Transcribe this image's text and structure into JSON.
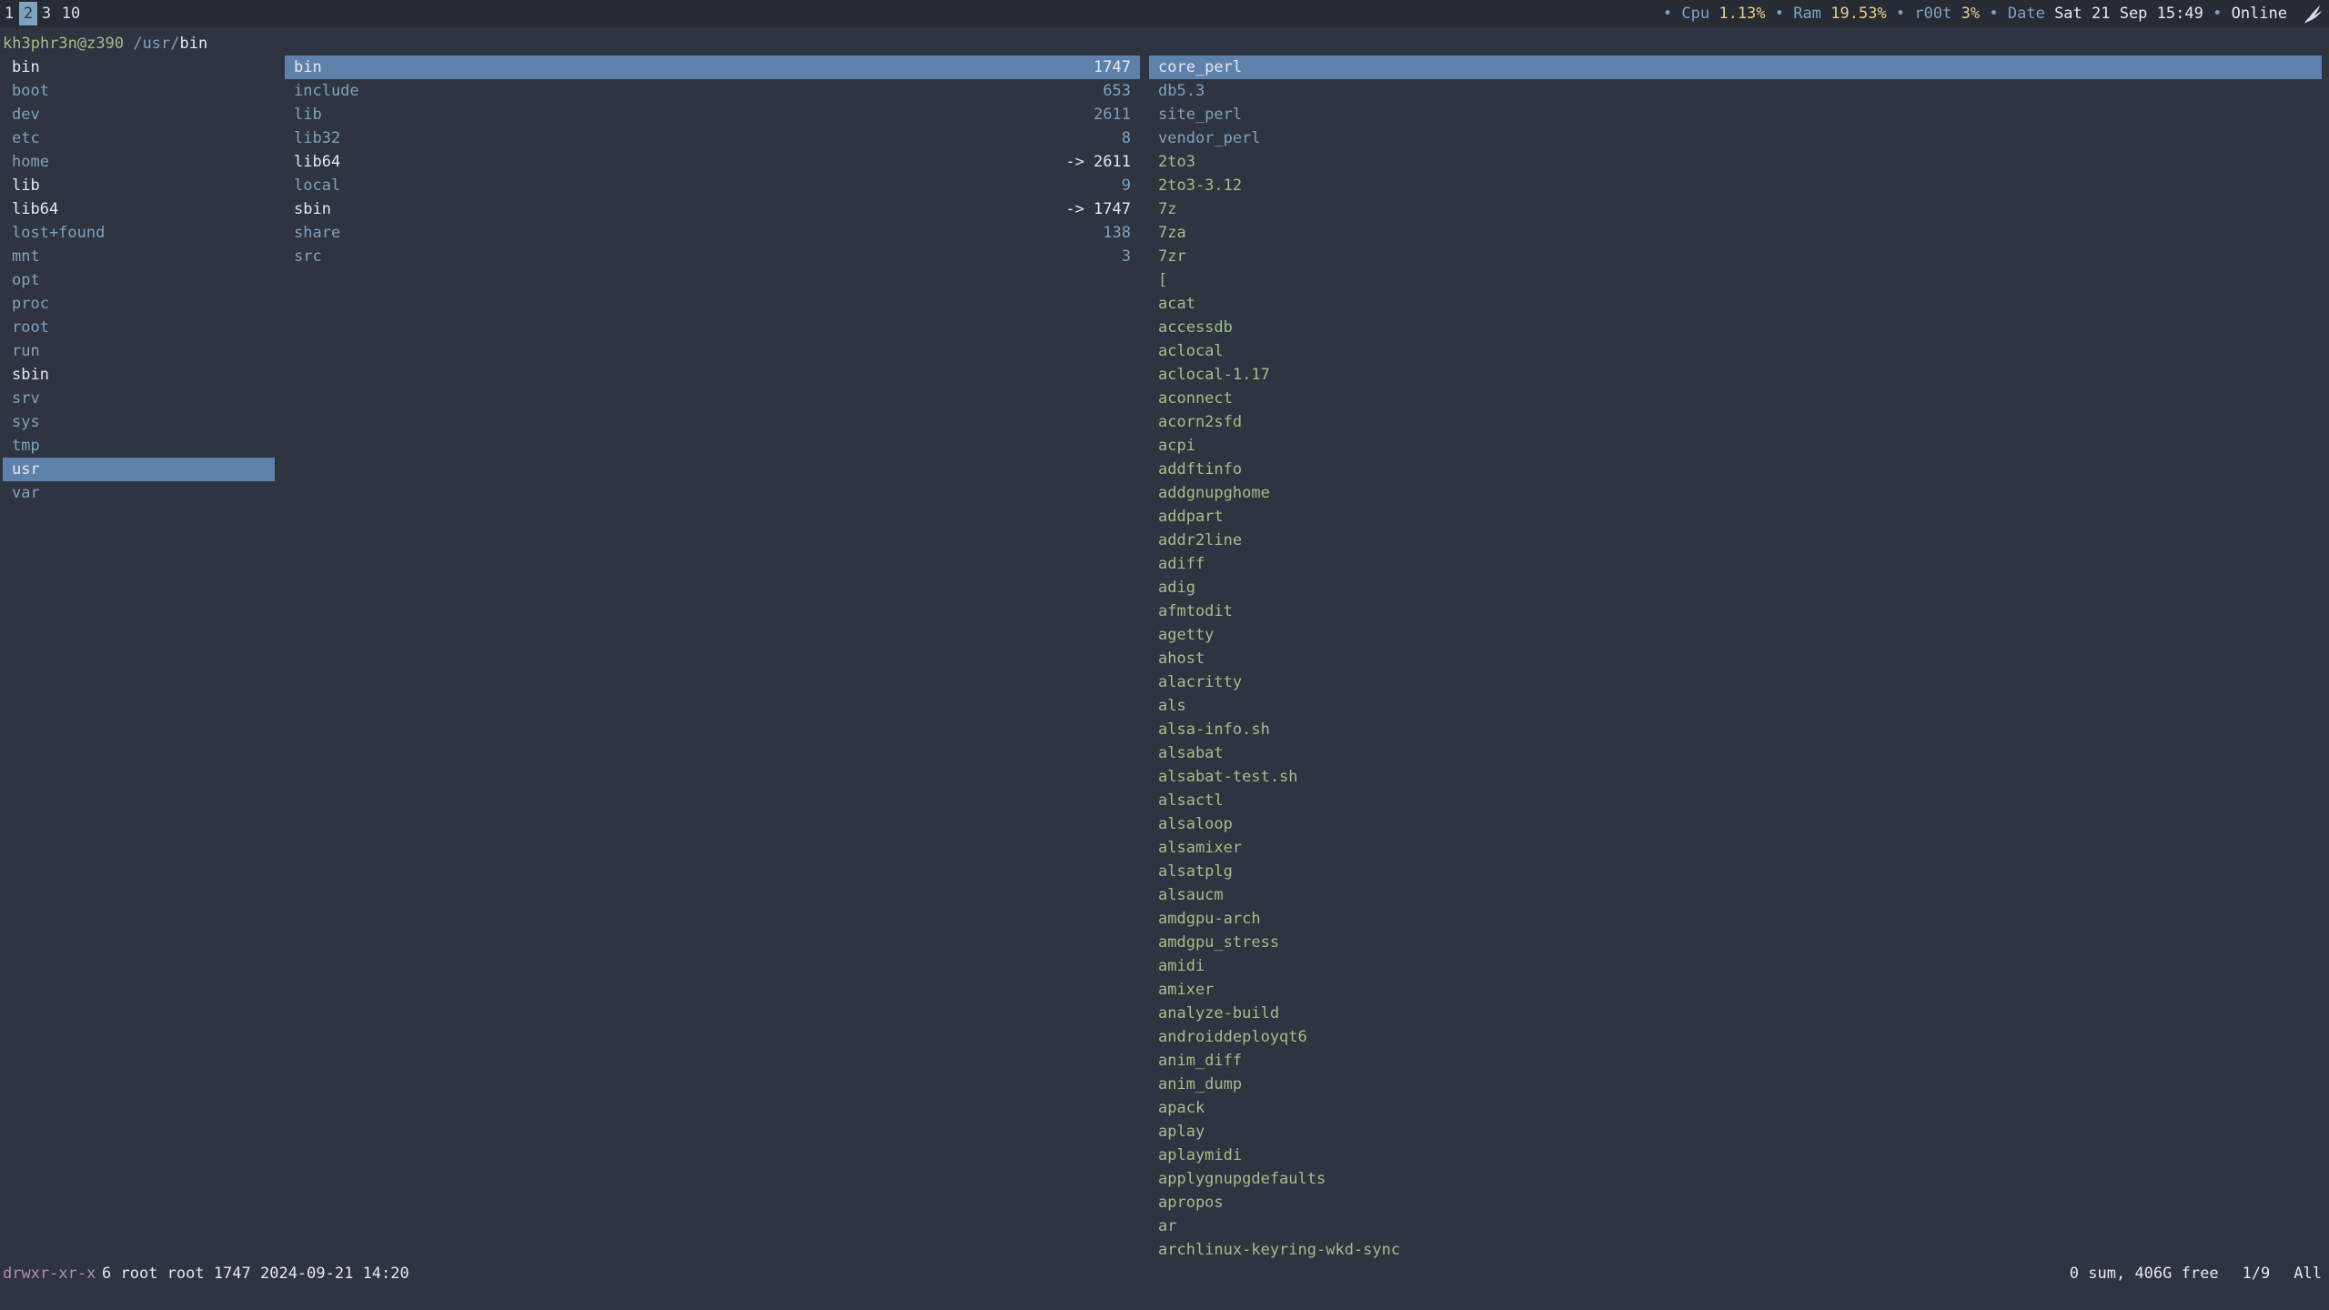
{
  "workspaces": [
    "1",
    "2",
    "3",
    "10"
  ],
  "status": {
    "cpu_label": "Cpu",
    "cpu_value": "1.13%",
    "ram_label": "Ram",
    "ram_value": "19.53%",
    "user_label": "r00t",
    "user_value": "3%",
    "date_label": "Date",
    "date_value": "Sat 21 Sep 15:49",
    "online": "Online",
    "bullet": "•"
  },
  "path": {
    "user_host": "kh3phr3n@z390",
    "dir": "/usr/",
    "current": "bin"
  },
  "parent_column": [
    "bin",
    "boot",
    "dev",
    "etc",
    "home",
    "lib",
    "lib64",
    "lost+found",
    "mnt",
    "opt",
    "proc",
    "root",
    "run",
    "sbin",
    "srv",
    "sys",
    "tmp",
    "usr",
    "var"
  ],
  "current_column": [
    {
      "name": "bin",
      "count": "1747"
    },
    {
      "name": "include",
      "count": "653"
    },
    {
      "name": "lib",
      "count": "2611"
    },
    {
      "name": "lib32",
      "count": "8"
    },
    {
      "name": "lib64",
      "count": "-> 2611"
    },
    {
      "name": "local",
      "count": "9"
    },
    {
      "name": "sbin",
      "count": "-> 1747"
    },
    {
      "name": "share",
      "count": "138"
    },
    {
      "name": "src",
      "count": "3"
    }
  ],
  "preview_column": [
    "core_perl",
    "db5.3",
    "site_perl",
    "vendor_perl",
    "2to3",
    "2to3-3.12",
    "7z",
    "7za",
    "7zr",
    "[",
    "acat",
    "accessdb",
    "aclocal",
    "aclocal-1.17",
    "aconnect",
    "acorn2sfd",
    "acpi",
    "addftinfo",
    "addgnupghome",
    "addpart",
    "addr2line",
    "adiff",
    "adig",
    "afmtodit",
    "agetty",
    "ahost",
    "alacritty",
    "als",
    "alsa-info.sh",
    "alsabat",
    "alsabat-test.sh",
    "alsactl",
    "alsaloop",
    "alsamixer",
    "alsatplg",
    "alsaucm",
    "amdgpu-arch",
    "amdgpu_stress",
    "amidi",
    "amixer",
    "analyze-build",
    "androiddeployqt6",
    "anim_diff",
    "anim_dump",
    "apack",
    "aplay",
    "aplaymidi",
    "applygnupgdefaults",
    "apropos",
    "ar",
    "archlinux-keyring-wkd-sync"
  ],
  "bottom": {
    "perms": "drwxr-xr-x",
    "info": "6 root root 1747 2024-09-21 14:20",
    "disk": "0 sum, 406G free",
    "position": "1/9",
    "scroll": "All"
  },
  "colors": {
    "background": "#2e3440",
    "topbar": "#262b34",
    "selection": "#5e81ac",
    "directory": "#81a1c1",
    "executable": "#a3be8c",
    "permissions": "#b48ead",
    "value": "#ebcb8b"
  },
  "icons": {
    "logo": "flame-logo-icon"
  }
}
